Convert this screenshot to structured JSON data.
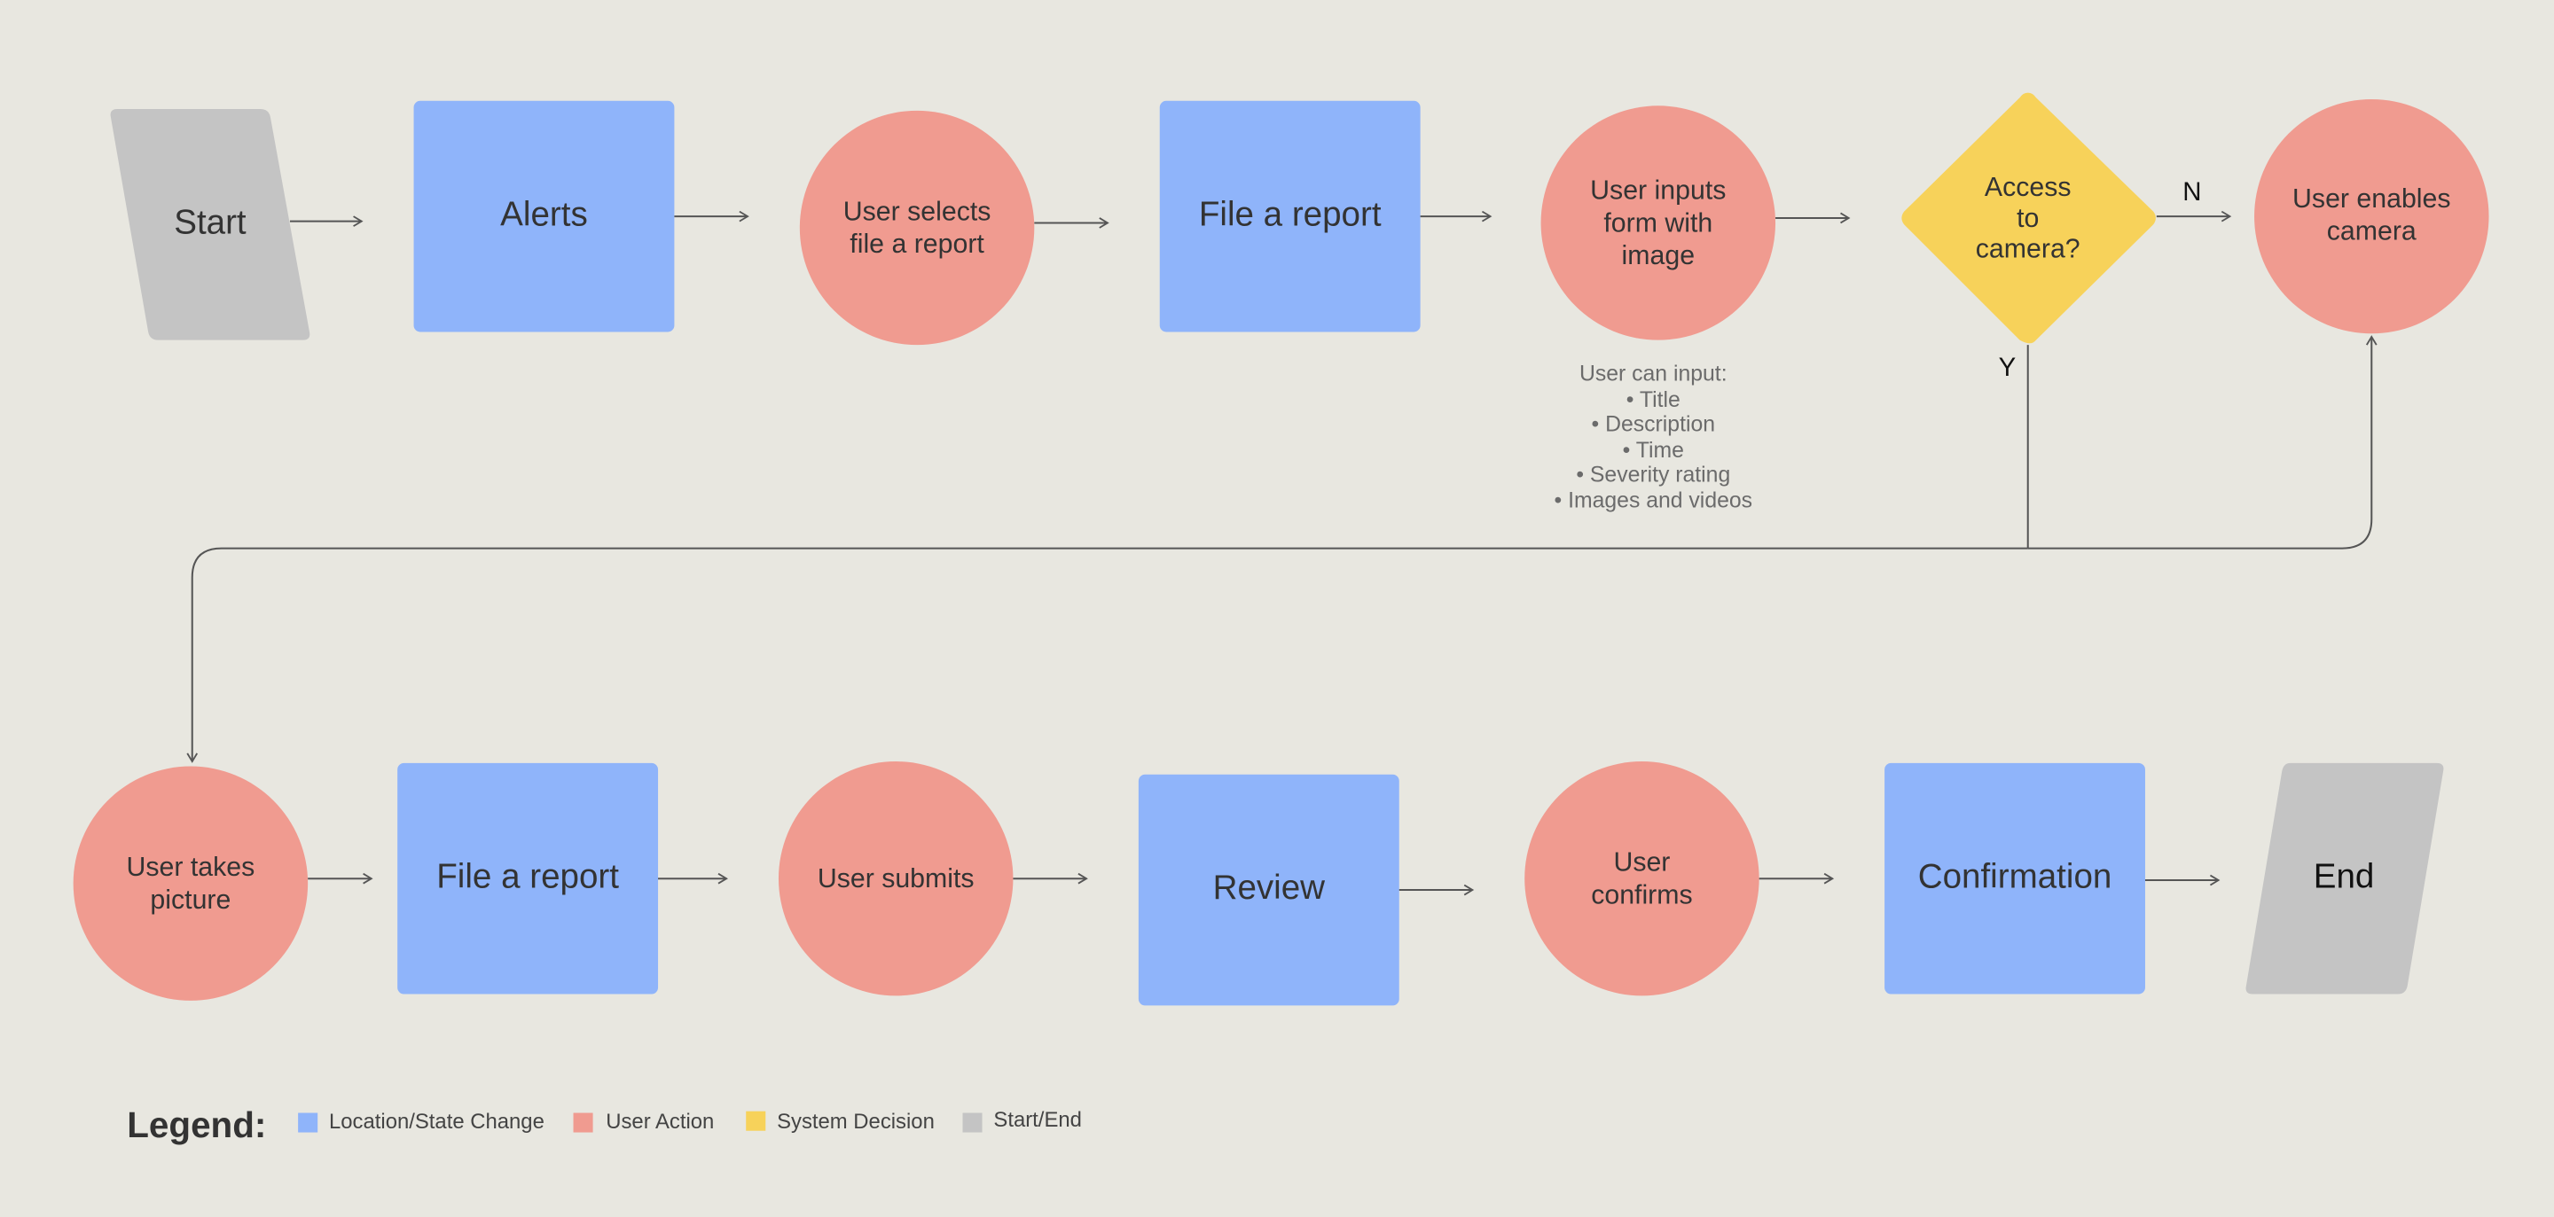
{
  "colors": {
    "background": "#e8e7e0",
    "location_state_change": "#8fb4fa",
    "user_action": "#f09b90",
    "system_decision": "#f7d25a",
    "start_end": "#c4c4c4",
    "connector": "#555555"
  },
  "nodes": {
    "start": "Start",
    "alerts": "Alerts",
    "user_selects": [
      "User selects",
      "file a report"
    ],
    "file_report_1": "File a report",
    "user_inputs": [
      "User inputs",
      "form with",
      "image"
    ],
    "decision": [
      "Access",
      "to",
      "camera?"
    ],
    "user_enables": [
      "User enables",
      "camera"
    ],
    "user_takes": [
      "User takes",
      "picture"
    ],
    "file_report_2": "File a report",
    "user_submits": "User submits",
    "review": "Review",
    "user_confirms": [
      "User",
      "confirms"
    ],
    "confirmation": "Confirmation",
    "end": "End"
  },
  "branch_labels": {
    "no": "N",
    "yes": "Y"
  },
  "note": {
    "heading": "User can input:",
    "items": [
      "Title",
      "Description",
      "Time",
      "Severity rating",
      "Images and videos"
    ]
  },
  "legend": {
    "title": "Legend:",
    "items": [
      {
        "label": "Location/State Change",
        "color_key": "location_state_change"
      },
      {
        "label": "User Action",
        "color_key": "user_action"
      },
      {
        "label": "System Decision",
        "color_key": "system_decision"
      },
      {
        "label": "Start/End",
        "color_key": "start_end"
      }
    ]
  }
}
